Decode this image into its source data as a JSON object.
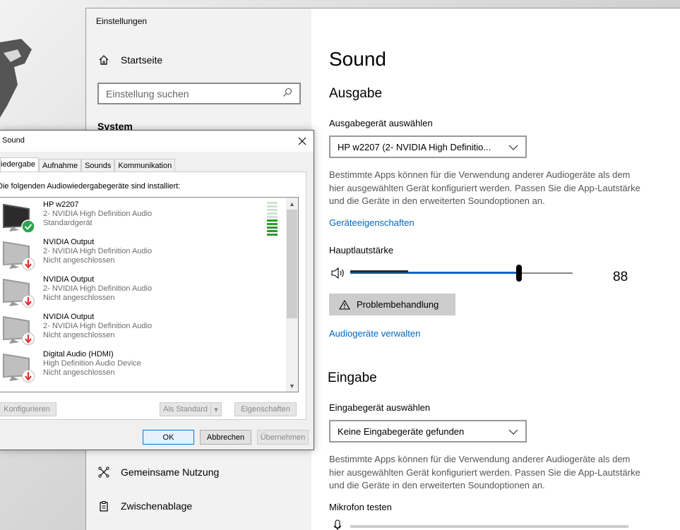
{
  "settings": {
    "window_title": "Einstellungen",
    "home_label": "Startseite",
    "search_placeholder": "Einstellung suchen",
    "section_system": "System",
    "nav_share": "Gemeinsame Nutzung",
    "nav_clipboard": "Zwischenablage"
  },
  "sound_page": {
    "title": "Sound",
    "output_heading": "Ausgabe",
    "output_select_label": "Ausgabegerät auswählen",
    "output_device": "HP w2207 (2- NVIDIA High Definitio...",
    "output_desc": "Bestimmte Apps können für die Verwendung anderer Audiogeräte als dem hier ausgewählten Gerät konfiguriert werden. Passen Sie die App-Lautstärke und die Geräte in den erweiterten Soundoptionen an.",
    "device_properties_link": "Geräteeigenschaften",
    "master_volume_label": "Hauptlautstärke",
    "volume_value": "88",
    "volume_level": 0.88,
    "peak_level": 0.5,
    "troubleshoot_button": "Problembehandlung",
    "manage_devices_link": "Audiogeräte verwalten",
    "input_heading": "Eingabe",
    "input_select_label": "Eingabegerät auswählen",
    "input_device": "Keine Eingabegeräte gefunden",
    "input_desc": "Bestimmte Apps können für die Verwendung anderer Audiogeräte als dem hier ausgewählten Gerät konfiguriert werden. Passen Sie die App-Lautstärke und die Geräte in den erweiterten Soundoptionen an.",
    "mic_test_label": "Mikrofon testen"
  },
  "sound_dialog": {
    "title": "Sound",
    "tabs": [
      "iedergabe",
      "Aufnahme",
      "Sounds",
      "Kommunikation"
    ],
    "intro": "Die folgenden Audiowiedergabegeräte sind installiert:",
    "devices": [
      {
        "name": "HP w2207",
        "driver": "2- NVIDIA High Definition Audio",
        "status": "Standardgerät",
        "badge": "check-badge-icon"
      },
      {
        "name": "NVIDIA Output",
        "driver": "2- NVIDIA High Definition Audio",
        "status": "Nicht angeschlossen",
        "badge": "disconnected-badge-icon"
      },
      {
        "name": "NVIDIA Output",
        "driver": "2- NVIDIA High Definition Audio",
        "status": "Nicht angeschlossen",
        "badge": "disconnected-badge-icon"
      },
      {
        "name": "NVIDIA Output",
        "driver": "2- NVIDIA High Definition Audio",
        "status": "Nicht angeschlossen",
        "badge": "disconnected-badge-icon"
      },
      {
        "name": "Digital Audio (HDMI)",
        "driver": "High Definition Audio Device",
        "status": "Nicht angeschlossen",
        "badge": "disconnected-badge-icon"
      }
    ],
    "meter_lit": 5,
    "meter_total": 10,
    "buttons": {
      "configure": "Konfigurieren",
      "set_default": "Als Standard",
      "properties": "Eigenschaften",
      "ok": "OK",
      "cancel": "Abbrechen",
      "apply": "Übernehmen"
    }
  },
  "colors": {
    "accent": "#0067c0",
    "meter_on": "#2e9b2e",
    "meter_off": "#cfe3d5",
    "check": "#2da44e",
    "disconnected": "#e03131"
  }
}
